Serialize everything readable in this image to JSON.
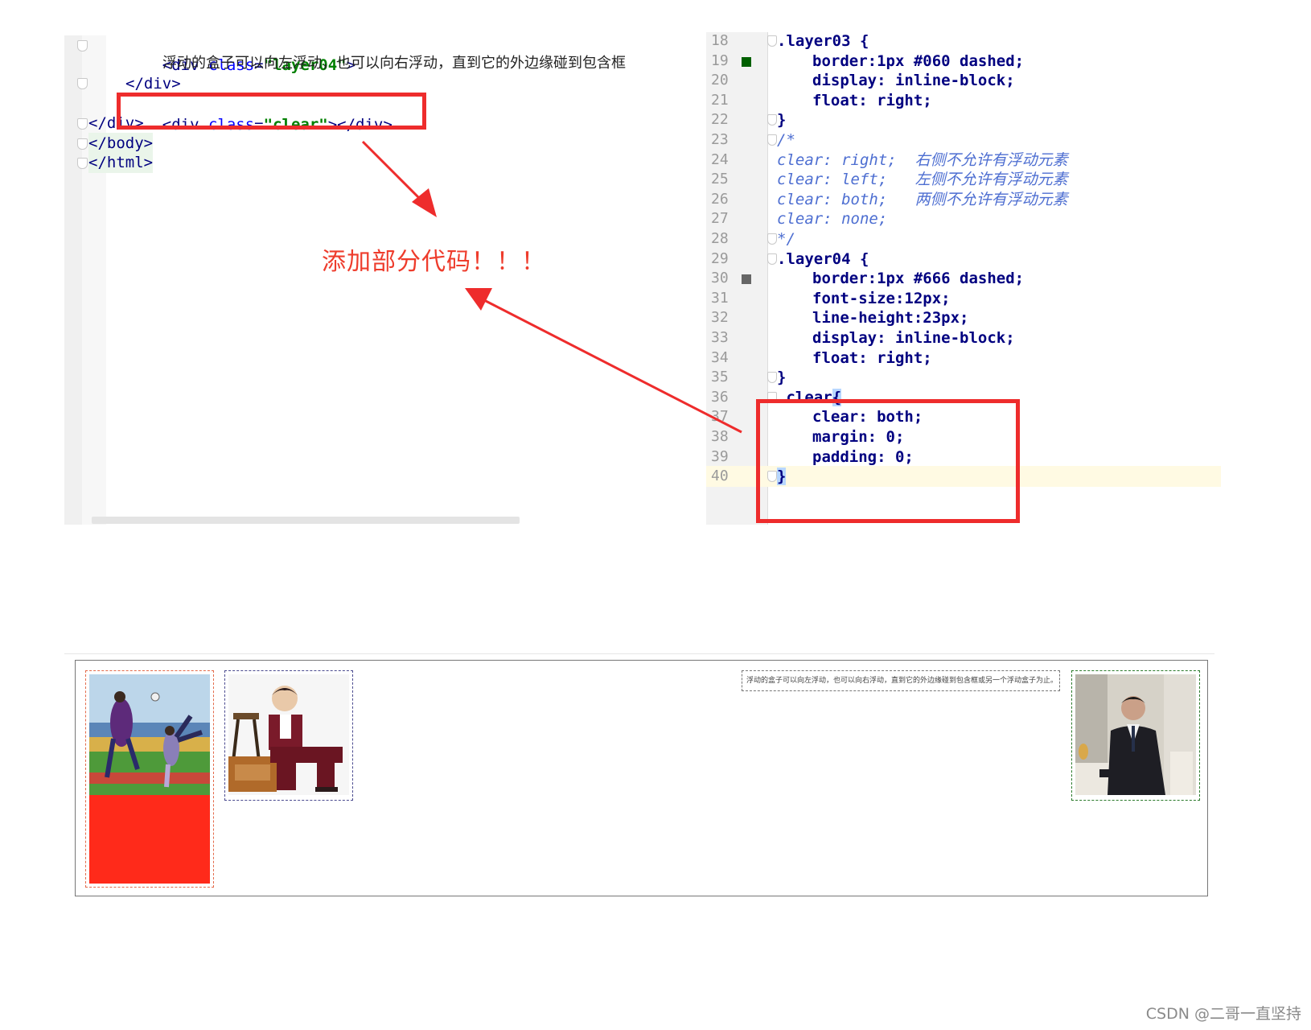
{
  "left_editor": {
    "lines": [
      {
        "open": "<div ",
        "attr": "class",
        "eq": "=",
        "value": "\"layer04\"",
        "close": ">"
      },
      {
        "text": "浮动的盒子可以向左浮动，也可以向右浮动，直到它的外边缘碰到包含框"
      },
      {
        "text": "</div>"
      },
      {
        "open": "<div ",
        "attr": "class",
        "eq": "=",
        "value": "\"clear\"",
        "close": "></div>"
      },
      {
        "text": "</div>"
      },
      {
        "text": "</body>"
      },
      {
        "text": "</html>"
      }
    ]
  },
  "right_editor": {
    "lines": [
      {
        "num": "18",
        "code": ".layer03 {"
      },
      {
        "num": "19",
        "prop": "border",
        "val": ":1px #060 dashed;"
      },
      {
        "num": "20",
        "prop": "display",
        "val": ": inline-block;"
      },
      {
        "num": "21",
        "prop": "float",
        "val": ": right;"
      },
      {
        "num": "22",
        "code": "}"
      },
      {
        "num": "23",
        "comment": "/*"
      },
      {
        "num": "24",
        "comment": "clear: right;  右侧不允许有浮动元素"
      },
      {
        "num": "25",
        "comment": "clear: left;   左侧不允许有浮动元素"
      },
      {
        "num": "26",
        "comment": "clear: both;   两侧不允许有浮动元素"
      },
      {
        "num": "27",
        "comment": "clear: none;"
      },
      {
        "num": "28",
        "comment": "*/"
      },
      {
        "num": "29",
        "code": ".layer04 {"
      },
      {
        "num": "30",
        "prop": "border",
        "val": ":1px #666 dashed;"
      },
      {
        "num": "31",
        "prop": "font-size",
        "val": ":12px;"
      },
      {
        "num": "32",
        "prop": "line-height",
        "val": ":23px;"
      },
      {
        "num": "33",
        "prop": "display",
        "val": ": inline-block;"
      },
      {
        "num": "34",
        "prop": "float",
        "val": ": right;"
      },
      {
        "num": "35",
        "code": "}"
      },
      {
        "num": "36",
        "code": ".clear",
        "brace": "{"
      },
      {
        "num": "37",
        "prop": "clear",
        "val": ": both;"
      },
      {
        "num": "38",
        "prop": "margin",
        "val": ": 0;"
      },
      {
        "num": "39",
        "prop": "padding",
        "val": ": 0;"
      },
      {
        "num": "40",
        "brace": "}"
      }
    ],
    "marker_colors": {
      "green": "#006000",
      "gray": "#666666"
    }
  },
  "annotation": {
    "text": "添加部分代码！！！",
    "color": "#ee2c2c"
  },
  "preview": {
    "layer04_text": "浮动的盒子可以向左浮动，也可以向右浮动，直到它的外边缘碰到包含框或另一个浮动盒子为止。",
    "images": [
      "soccer-photo",
      "boy-portrait-photo",
      "businessman-photo"
    ]
  },
  "watermark": "CSDN @二哥一直坚持"
}
